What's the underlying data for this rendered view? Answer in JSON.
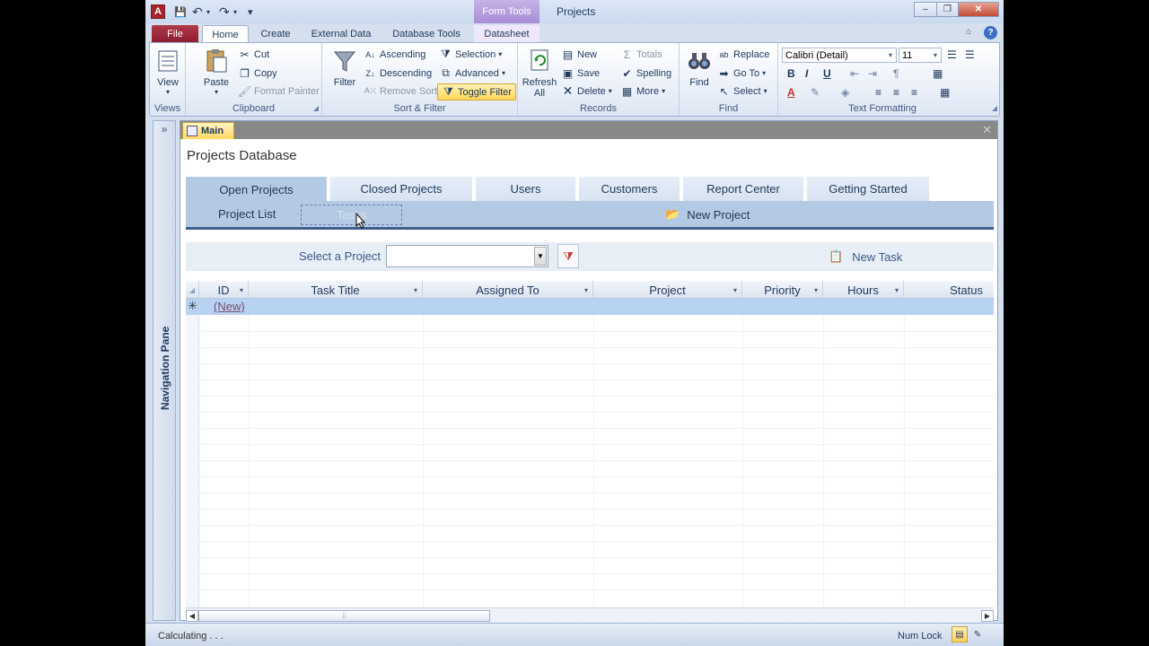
{
  "window": {
    "doc_title": "Projects",
    "context_tab_group": "Form Tools",
    "app_icon_letter": "A",
    "controls": {
      "minimize": "–",
      "restore": "❐",
      "close": "✕"
    }
  },
  "qat": {
    "save": "💾",
    "undo": "↶",
    "redo": "↷",
    "customize": "▾"
  },
  "ribbon_tabs": {
    "file": "File",
    "home": "Home",
    "create": "Create",
    "external_data": "External Data",
    "database_tools": "Database Tools",
    "datasheet": "Datasheet",
    "help": "?"
  },
  "ribbon": {
    "views": {
      "label": "Views",
      "view": "View"
    },
    "clipboard": {
      "label": "Clipboard",
      "paste": "Paste",
      "cut": "Cut",
      "copy": "Copy",
      "format_painter": "Format Painter"
    },
    "sort_filter": {
      "label": "Sort & Filter",
      "filter": "Filter",
      "ascending": "Ascending",
      "descending": "Descending",
      "remove_sort": "Remove Sort",
      "selection": "Selection",
      "advanced": "Advanced",
      "toggle_filter": "Toggle Filter"
    },
    "records": {
      "label": "Records",
      "refresh_all": "Refresh",
      "refresh_all_2": "All",
      "new": "New",
      "save": "Save",
      "delete": "Delete",
      "totals": "Totals",
      "spelling": "Spelling",
      "more": "More"
    },
    "find": {
      "label": "Find",
      "find": "Find",
      "replace": "Replace",
      "go_to": "Go To",
      "select": "Select"
    },
    "text_formatting": {
      "label": "Text Formatting",
      "font": "Calibri (Detail)",
      "size": "11"
    }
  },
  "nav_pane": {
    "label": "Navigation Pane",
    "toggle": "»"
  },
  "document": {
    "tab": "Main",
    "form_title": "Projects Database",
    "tabs": [
      "Open Projects",
      "Closed Projects",
      "Users",
      "Customers",
      "Report Center",
      "Getting Started"
    ],
    "subnav": {
      "project_list": "Project List",
      "tasks": "Tasks",
      "new_project": "New Project"
    },
    "filter": {
      "label": "Select a Project",
      "value": "",
      "new_task": "New Task"
    },
    "grid": {
      "columns": [
        "ID",
        "Task Title",
        "Assigned To",
        "Project",
        "Priority",
        "Hours",
        "Status"
      ],
      "new_row_marker": "✳",
      "new_row_text": "(New)"
    }
  },
  "status_bar": {
    "text": "Calculating . . .",
    "num_lock": "Num Lock"
  }
}
